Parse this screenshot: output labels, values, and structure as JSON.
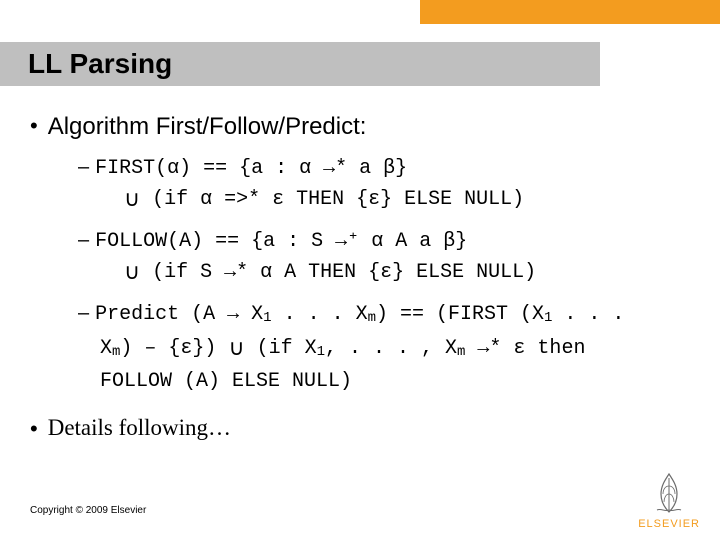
{
  "header": {
    "title": "LL Parsing"
  },
  "main": {
    "bullet1": "Algorithm First/Follow/Predict:",
    "first": {
      "line1": "FIRST(α) == {a : α  →* a β}",
      "line2": " (if α =>* ε THEN {ε} ELSE NULL)"
    },
    "follow": {
      "line1": "FOLLOW(A) == {a : S →⁺ α A a β}",
      "line2": " (if S →* α A THEN {ε} ELSE NULL)"
    },
    "predict": {
      "line1_a": "Predict (A → X",
      "line1_b": " . . . X",
      "line1_c": ") == (FIRST (X",
      "line1_d": " . . .",
      "line2_a": "X",
      "line2_b": ") – {ε})  ",
      "line2_c": "  (if X",
      "line2_d": ", . . . , X",
      "line2_e": " →* ε then",
      "line3": "FOLLOW (A) ELSE NULL)"
    },
    "bullet2": "Details following…"
  },
  "footer": {
    "copyright": "Copyright © 2009 Elsevier",
    "brand": "ELSEVIER"
  },
  "sub": {
    "one": "1",
    "m": "m"
  },
  "sym": {
    "union": "∪",
    "dash": "–"
  }
}
